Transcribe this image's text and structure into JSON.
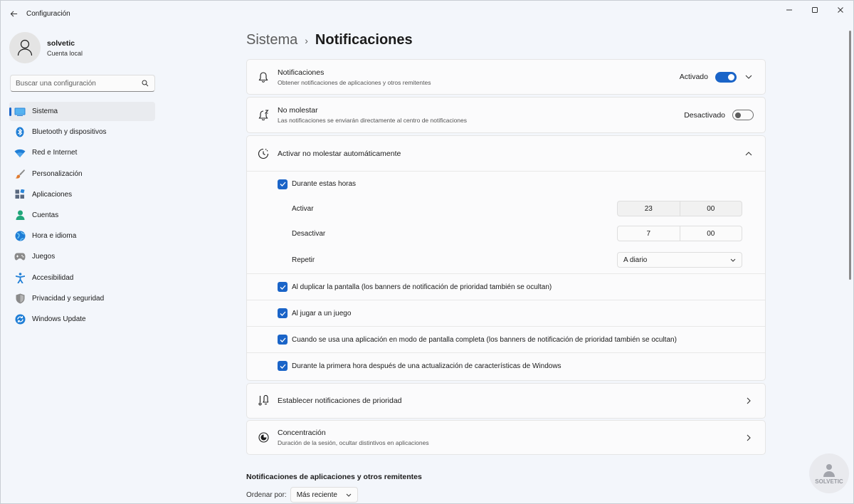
{
  "window": {
    "title": "Configuración",
    "controls": [
      "minimize-icon",
      "maximize-icon",
      "close-icon"
    ]
  },
  "profile": {
    "name": "solvetic",
    "account_type": "Cuenta local"
  },
  "search": {
    "placeholder": "Buscar una configuración"
  },
  "sidebar": {
    "items": [
      {
        "label": "Sistema",
        "icon": "system-icon",
        "active": true
      },
      {
        "label": "Bluetooth y dispositivos",
        "icon": "bluetooth-icon"
      },
      {
        "label": "Red e Internet",
        "icon": "wifi-icon"
      },
      {
        "label": "Personalización",
        "icon": "brush-icon"
      },
      {
        "label": "Aplicaciones",
        "icon": "apps-icon"
      },
      {
        "label": "Cuentas",
        "icon": "person-icon"
      },
      {
        "label": "Hora e idioma",
        "icon": "globe-icon"
      },
      {
        "label": "Juegos",
        "icon": "gamepad-icon"
      },
      {
        "label": "Accesibilidad",
        "icon": "accessibility-icon"
      },
      {
        "label": "Privacidad y seguridad",
        "icon": "shield-icon"
      },
      {
        "label": "Windows Update",
        "icon": "update-icon"
      }
    ]
  },
  "breadcrumb": {
    "parent": "Sistema",
    "separator": "›",
    "current": "Notificaciones"
  },
  "notifications_card": {
    "title": "Notificaciones",
    "subtitle": "Obtener notificaciones de aplicaciones y otros remitentes",
    "state": "Activado",
    "toggle_on": true
  },
  "dnd_card": {
    "title": "No molestar",
    "subtitle": "Las notificaciones se enviarán directamente al centro de notificaciones",
    "state": "Desactivado",
    "toggle_on": false
  },
  "auto_dnd": {
    "title": "Activar no molestar automáticamente",
    "during_hours": {
      "label": "Durante estas horas",
      "checked": true
    },
    "on_time": {
      "label": "Activar",
      "hour": "23",
      "minute": "00"
    },
    "off_time": {
      "label": "Desactivar",
      "hour": "7",
      "minute": "00"
    },
    "repeat": {
      "label": "Repetir",
      "value": "A diario"
    },
    "options": [
      {
        "label": "Al duplicar la pantalla (los banners de notificación de prioridad también se ocultan)",
        "checked": true
      },
      {
        "label": "Al jugar a un juego",
        "checked": true
      },
      {
        "label": "Cuando se usa una aplicación en modo de pantalla completa (los banners de notificación de prioridad también se ocultan)",
        "checked": true
      },
      {
        "label": "Durante la primera hora después de una actualización de características de Windows",
        "checked": true
      }
    ]
  },
  "priority_card": {
    "title": "Establecer notificaciones de prioridad"
  },
  "focus_card": {
    "title": "Concentración",
    "subtitle": "Duración de la sesión, ocultar distintivos en aplicaciones"
  },
  "apps_section": {
    "title": "Notificaciones de aplicaciones y otros remitentes",
    "sort_label": "Ordenar por:",
    "sort_value": "Más reciente"
  },
  "watermark": {
    "text": "SOLVETIC"
  },
  "colors": {
    "accent": "#1a64c8",
    "background": "#f3f6fb",
    "card": "#fbfbfc"
  }
}
